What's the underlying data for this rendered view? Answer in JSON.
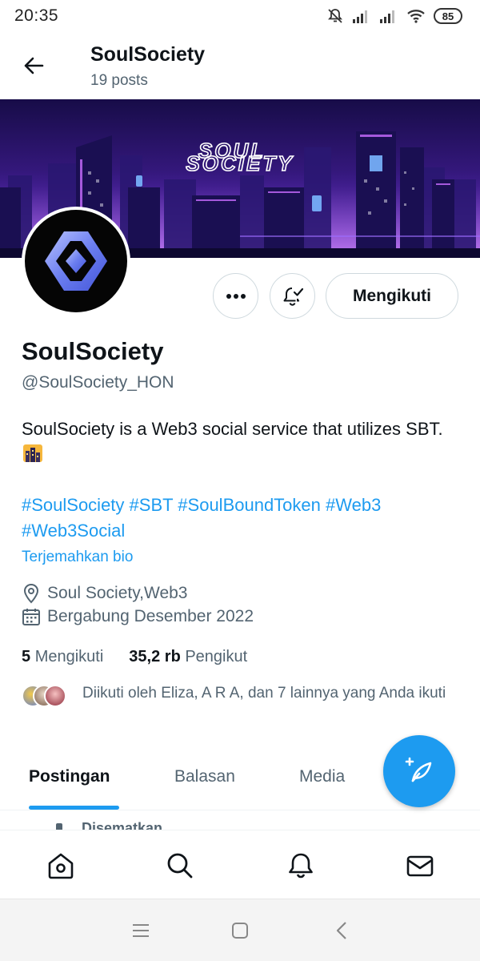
{
  "status_bar": {
    "time": "20:35",
    "battery": "85"
  },
  "header": {
    "name": "SoulSociety",
    "post_count": "19 posts"
  },
  "banner": {
    "logo_line1": "SOUL",
    "logo_line2": "SOCIETY"
  },
  "actions": {
    "follow_label": "Mengikuti"
  },
  "profile": {
    "name": "SoulSociety",
    "handle": "@SoulSociety_HON",
    "bio": "SoulSociety is a Web3 social service that utilizes SBT.",
    "hashtags": [
      "#SoulSociety",
      "#SBT",
      "#SoulBoundToken",
      "#Web3",
      "#Web3Social"
    ],
    "translate_label": "Terjemahkan bio",
    "location": "Soul Society,Web3",
    "joined": "Bergabung Desember 2022",
    "following_count": "5",
    "following_label": "Mengikuti",
    "followers_count": "35,2 rb",
    "followers_label": "Pengikut",
    "followers_you_know": "Diikuti oleh Eliza, A R A, dan 7 lainnya yang Anda ikuti"
  },
  "tabs": [
    {
      "label": "Postingan",
      "active": true
    },
    {
      "label": "Balasan",
      "active": false
    },
    {
      "label": "Media",
      "active": false
    }
  ],
  "pinned_label": "Disematkan",
  "colors": {
    "accent": "#1d9bf0",
    "text": "#0f1419",
    "secondary": "#536471",
    "border": "#cfd9de"
  },
  "icons": {
    "back": "arrow-left-icon",
    "more": "more-horizontal-icon",
    "notify": "bell-check-icon",
    "location": "location-pin-icon",
    "calendar": "calendar-icon",
    "compose": "feather-plus-icon",
    "nav": [
      "home-icon",
      "search-icon",
      "bell-icon",
      "mail-icon"
    ]
  }
}
